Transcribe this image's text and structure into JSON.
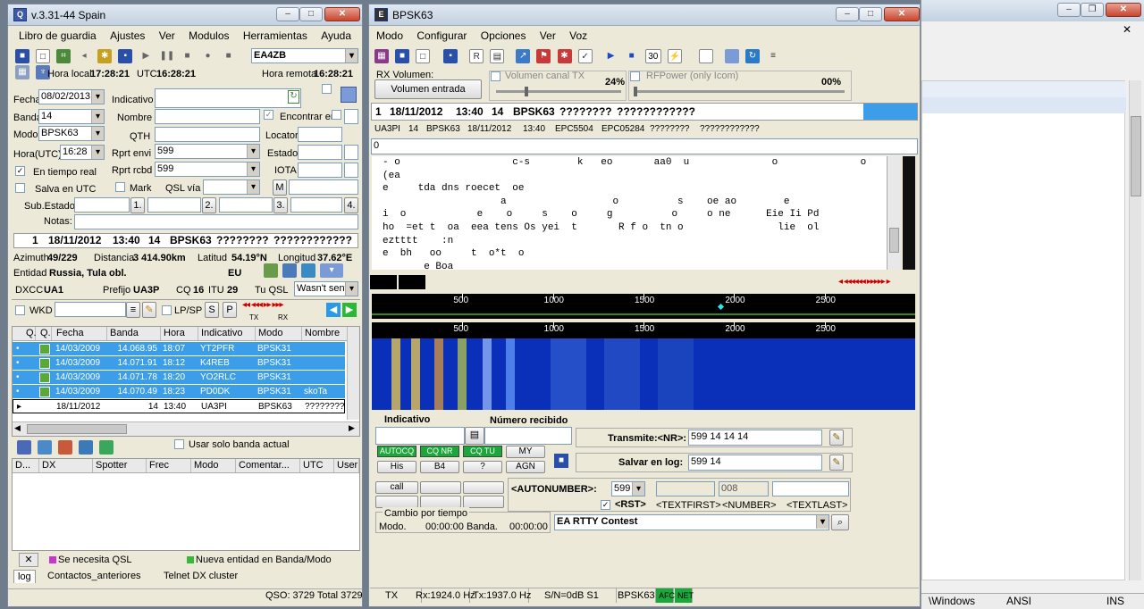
{
  "bg_window": {
    "status": {
      "windows": "\\Windows",
      "ansi": "ANSI",
      "ins": "INS"
    }
  },
  "log_window": {
    "title": "v.3.31-44 Spain",
    "menu": [
      "Libro de guardia",
      "Ajustes",
      "Ver",
      "Modulos",
      "Herramientas",
      "Ayuda"
    ],
    "station": "EA4ZB",
    "time": {
      "local_label": "Hora local",
      "local_value": "17:28:21",
      "utc_label": "UTC",
      "utc_value": "16:28:21",
      "remote_label": "Hora remota",
      "remote_value": "16:28:21"
    },
    "form": {
      "fecha_label": "Fecha",
      "fecha": "08/02/2013",
      "indicativo_label": "Indicativo",
      "indicativo": "",
      "banda_label": "Banda",
      "banda": "14",
      "nombre_label": "Nombre",
      "encontrar_label": "Encontrar en",
      "modo_label": "Modo",
      "modo": "BPSK63",
      "qth_label": "QTH",
      "locator_label": "Locator",
      "hora_label": "Hora(UTC)",
      "hora": "16:28",
      "rprt_envi_label": "Rprt envi",
      "rprt_envi": "599",
      "estado_label": "Estado",
      "tiempo_real_label": "En tiempo real",
      "rprt_rcbd_label": "Rprt rcbd",
      "rprt_rcbd": "599",
      "iota_label": "IOTA",
      "salva_utc_label": "Salva en UTC",
      "mark_label": "Mark",
      "qsl_via_label": "QSL vía",
      "m_label": "M",
      "sub_estado_label": "Sub.Estado:",
      "sub_btns": [
        "1.",
        "2.",
        "3.",
        "4."
      ],
      "notas_label": "Notas:"
    },
    "info": {
      "row": [
        "1",
        "18/11/2012",
        "13:40",
        "14",
        "BPSK63",
        "????????",
        "????????????"
      ],
      "azimuth_label": "Azimuth",
      "azimuth": "49/229",
      "distancia_label": "Distancia",
      "distancia": "3 414.90km",
      "latitud_label": "Latitud",
      "latitud": "54.19°N",
      "longitud_label": "Longitud",
      "longitud": "37.62°E",
      "entidad_label": "Entidad",
      "entidad": "Russia, Tula obl.",
      "continent": "EU",
      "dxcc_label": "DXCC",
      "dxcc": "UA1",
      "prefijo_label": "Prefijo",
      "prefijo": "UA3P",
      "cq_label": "CQ",
      "cq": "16",
      "itu_label": "ITU",
      "itu": "29",
      "tu_qsl_label": "Tu QSL",
      "tu_qsl": "Wasn't sent"
    },
    "wkd_label": "WKD",
    "lpsp_label": "LP/SP",
    "s_btn": "S",
    "p_btn": "P",
    "tx_label": "TX",
    "rx_label": "RX",
    "grid": {
      "columns": [
        "Q.",
        "Q.",
        "Fecha",
        "Banda",
        "Hora",
        "Indicativo",
        "Modo",
        "Nombre"
      ],
      "rows": [
        [
          "14/03/2009",
          "14.068.95",
          "18:07",
          "YT2PFR",
          "BPSK31",
          ""
        ],
        [
          "14/03/2009",
          "14.071.91",
          "18:12",
          "K4REB",
          "BPSK31",
          ""
        ],
        [
          "14/03/2009",
          "14.071.78",
          "18:20",
          "YO2RLC",
          "BPSK31",
          ""
        ],
        [
          "14/03/2009",
          "14.070.49",
          "18:23",
          "PD0DK",
          "BPSK31",
          "skoTa"
        ],
        [
          "18/11/2012",
          "14",
          "13:40",
          "UA3PI",
          "BPSK63",
          "????????"
        ]
      ]
    },
    "usar_banda_label": "Usar solo banda actual",
    "spot_columns": [
      "D...",
      "DX",
      "Spotter",
      "Frec",
      "Modo",
      "Comentar...",
      "UTC",
      "User"
    ],
    "legend": {
      "qsl": "Se necesita QSL",
      "entity": "Nueva entidad en Banda/Modo"
    },
    "tabs": [
      "log",
      "Contactos_anteriores",
      "Telnet DX cluster"
    ],
    "status": "QSO: 3729 Total 3729"
  },
  "modem_window": {
    "title": "BPSK63",
    "menu": [
      "Modo",
      "Configurar",
      "Opciones",
      "Ver",
      "Voz"
    ],
    "afc_num": "30",
    "rx_volumen_label": "RX Volumen:",
    "volumen_entrada": "Volumen entrada",
    "vol_tx_label": "Volumen canal TX",
    "vol_tx_pct": "24%",
    "rfpower_label": "RFPower (only Icom)",
    "rf_pct": "00%",
    "qso_row": [
      "1",
      "18/11/2012",
      "13:40",
      "14",
      "BPSK63",
      "????????",
      "????????????"
    ],
    "info_row": [
      "UA3PI",
      "14",
      "BPSK63",
      "18/11/2012",
      "13:40",
      "EPC5504",
      "EPC05284",
      "????????",
      "????????????"
    ],
    "zero": "0",
    "rx_lines": [
      "- o                   c-s        k   eo       aa0  u              o              o",
      "(ea",
      "e     tda dns roecet  oe",
      "                    a                  o          s    oe ao        e",
      "i  o            e    o     s    o     g          o     o ne      Eie Ii Pd",
      "ho  =et t  oa  eea tens Os yei  t       R f o  tn o                lie  ol",
      "eztttt    :n",
      "e  bh   oo     t  o*t  o",
      "       e Boa"
    ],
    "scale_ticks": [
      "500",
      "1000",
      "1500",
      "2000",
      "2500"
    ],
    "indicativo_label": "Indicativo",
    "numero_label": "Número recibido",
    "macro_green": [
      "AUTOCQ",
      "CQ NR",
      "CQ TU"
    ],
    "macro_my": "MY",
    "macro_row2": [
      "His",
      "B4",
      "?",
      "AGN"
    ],
    "transmite_label": "Transmite:<NR>:",
    "transmite": "599 14 14 14",
    "salvar_label": "Salvar en log:",
    "salvar": "599 14",
    "call_btn": "call",
    "autonumber_label": "<AUTONUMBER>:",
    "autonumber": "599",
    "num_field": "008",
    "rst_label": "<RST>",
    "textfirst": "<TEXTFIRST>",
    "number": "<NUMBER>",
    "textlast": "<TEXTLAST>",
    "cambio_label": "Cambio por tiempo",
    "modo_label": "Modo.",
    "modo_time": "00:00:00",
    "banda_label": "Banda.",
    "banda_time": "00:00:00",
    "contest": "EA RTTY Contest",
    "status": {
      "tx": "TX",
      "rx": "Rx:1924.0 Hz",
      "txf": "Tx:1937.0 Hz",
      "sn": "S/N=0dB S1",
      "mode": "BPSK63",
      "afc": "AFC",
      "net": "NET"
    }
  },
  "colors": {
    "accent": "#3c9de8",
    "green": "#1aa83a",
    "waterfall": "#0a2fb8"
  }
}
